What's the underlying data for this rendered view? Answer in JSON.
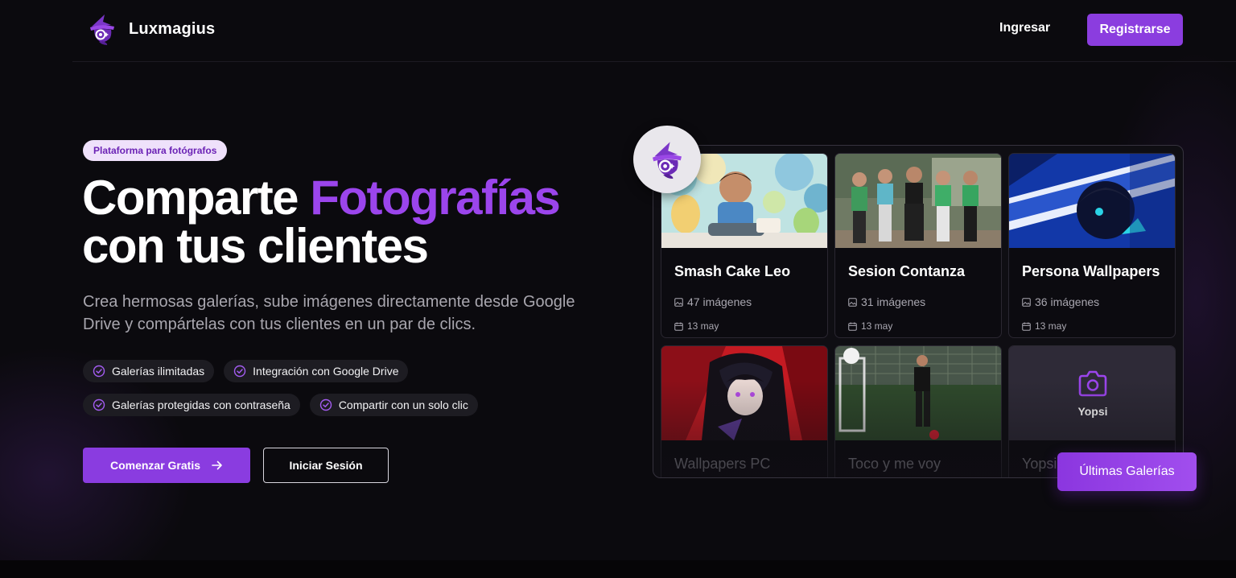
{
  "header": {
    "brand_name": "Luxmagius",
    "login_label": "Ingresar",
    "register_label": "Registrarse"
  },
  "hero": {
    "badge": "Plataforma para fotógrafos",
    "title_part1": "Comparte ",
    "title_accent": "Fotografías",
    "title_part2": "con tus clientes",
    "subtitle": "Crea hermosas galerías, sube imágenes directamente desde Google Drive y compártelas con tus clientes en un par de clics.",
    "features": [
      "Galerías ilimitadas",
      "Integración con Google Drive",
      "Galerías protegidas con contraseña",
      "Compartir con un solo clic"
    ],
    "primary_cta": "Comenzar Gratis",
    "secondary_cta": "Iniciar Sesión"
  },
  "galleries": [
    {
      "title": "Smash Cake Leo",
      "count": "47 imágenes",
      "date": "13 may"
    },
    {
      "title": "Sesion Contanza",
      "count": "31 imágenes",
      "date": "13 may"
    },
    {
      "title": "Persona Wallpapers",
      "count": "36 imágenes",
      "date": "13 may"
    },
    {
      "title": "Wallpapers PC"
    },
    {
      "title": "Toco y me voy"
    },
    {
      "title": "Yopsi",
      "placeholder_label": "Yopsi"
    }
  ],
  "latest_button": "Últimas Galerías",
  "colors": {
    "accent": "#8b3ddf",
    "accent_text": "#9b45ec",
    "background": "#0b0a0e",
    "badge_bg": "#efe1fb"
  },
  "icons": [
    "wizard-logo-icon",
    "check-circle-icon",
    "arrow-right-icon",
    "image-icon",
    "calendar-icon",
    "camera-icon"
  ]
}
